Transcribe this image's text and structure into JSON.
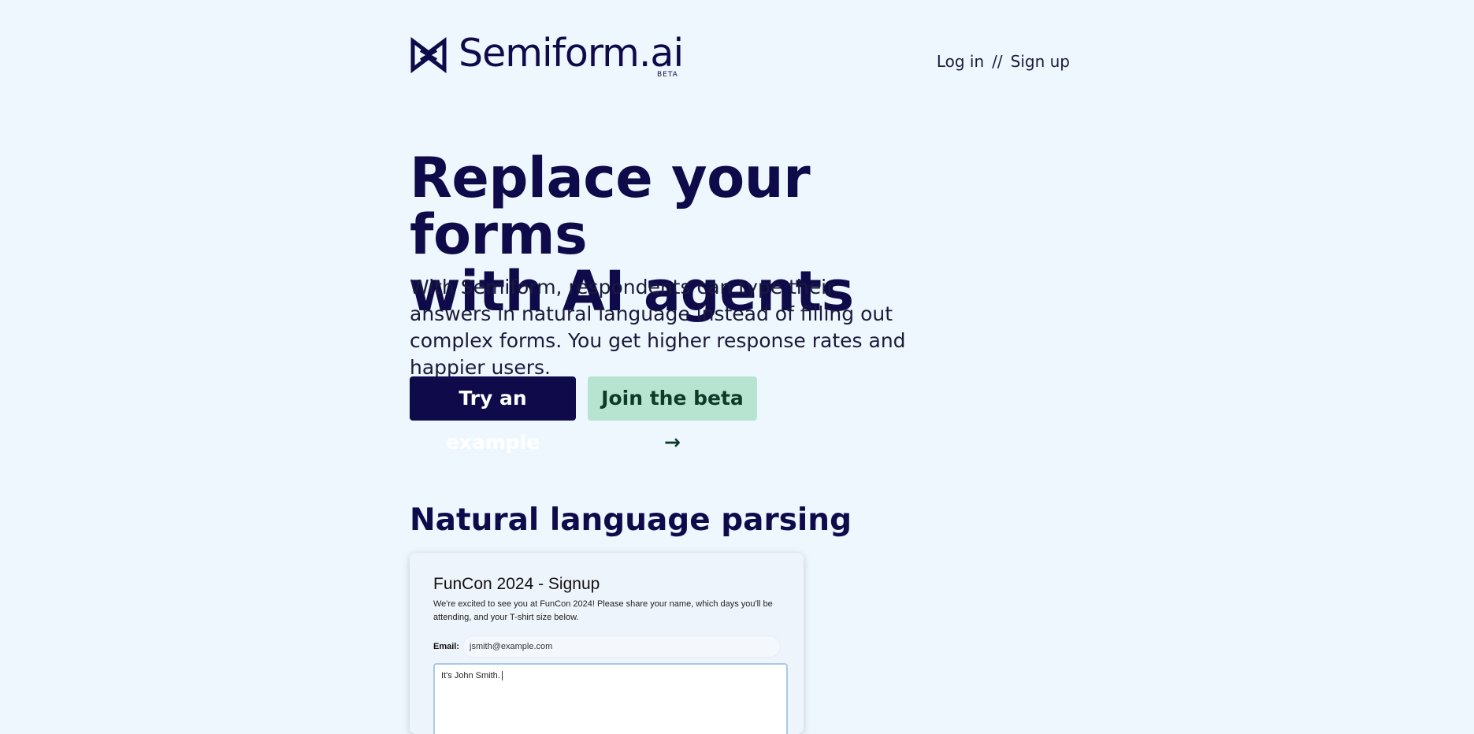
{
  "header": {
    "brand_name": "Semiform.ai",
    "beta_tag": "BETA",
    "login_label": "Log in",
    "separator": "//",
    "signup_label": "Sign up"
  },
  "hero": {
    "title_line1": "Replace your forms",
    "title_line2": "with AI agents",
    "description": "With Semiform, respondents can type their answers in natural language instead of filling out complex forms. You get higher response rates and happier users.",
    "try_example_label": "Try an example",
    "join_beta_label": "Join the beta →"
  },
  "section": {
    "title": "Natural language parsing"
  },
  "demo_form": {
    "title": "FunCon 2024 - Signup",
    "description": "We're excited to see you at FunCon 2024! Please share your name, which days you'll be attending, and your T-shirt size below.",
    "email_label": "Email:",
    "email_value": "jsmith@example.com",
    "message_value": "It's John Smith."
  },
  "colors": {
    "background": "#eef7fe",
    "brand_navy": "#0f0a4a",
    "beta_button_bg": "#b7e4d1"
  }
}
